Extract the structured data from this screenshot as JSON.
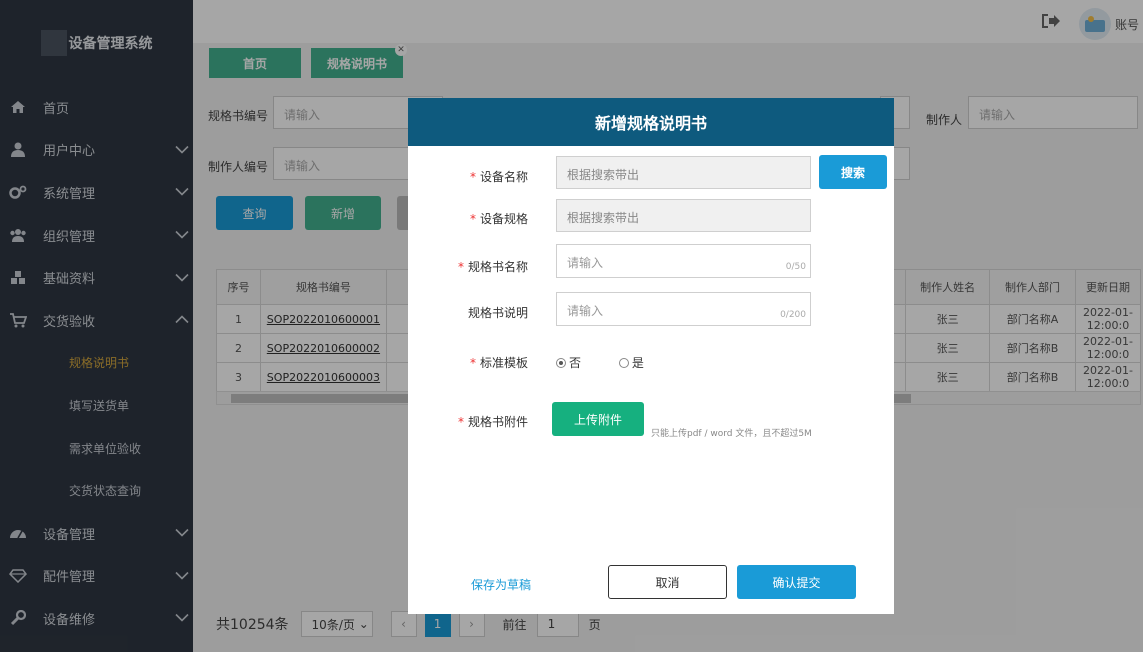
{
  "sidebar": {
    "brand": "设备管理系统",
    "items": [
      {
        "label": "首页",
        "icon": "home-icon",
        "chevron": ""
      },
      {
        "label": "用户中心",
        "icon": "user-icon",
        "chevron": "down"
      },
      {
        "label": "系统管理",
        "icon": "gears-icon",
        "chevron": "down"
      },
      {
        "label": "组织管理",
        "icon": "group-icon",
        "chevron": "down"
      },
      {
        "label": "基础资料",
        "icon": "cubes-icon",
        "chevron": "down"
      },
      {
        "label": "交货验收",
        "icon": "cart-icon",
        "chevron": "up"
      }
    ],
    "subitems": [
      "规格说明书",
      "填写送货单",
      "需求单位验收",
      "交货状态查询"
    ],
    "items2": [
      {
        "label": "设备管理",
        "icon": "dashboard-icon"
      },
      {
        "label": "配件管理",
        "icon": "diamond-icon"
      },
      {
        "label": "设备维修",
        "icon": "wrench-icon"
      }
    ]
  },
  "topbar": {
    "account": "账号"
  },
  "tabs": {
    "home": "首页",
    "spec": "规格说明书"
  },
  "filters": {
    "spec_code_label": "规格书编号",
    "creator_code_label": "制作人编号",
    "creator_label": "制作人",
    "placeholder": "请输入"
  },
  "buttons": {
    "query": "查询",
    "add": "新增"
  },
  "table": {
    "headers": [
      "序号",
      "规格书编号",
      "规",
      "制作人姓名",
      "制作人部门",
      "更新日期"
    ],
    "rows": [
      {
        "no": "1",
        "code": "SOP2022010600001",
        "name": "张三",
        "dept": "部门名称A",
        "date1": "2022-01-",
        "date2": "12:00:0"
      },
      {
        "no": "2",
        "code": "SOP2022010600002",
        "name": "张三",
        "dept": "部门名称B",
        "date1": "2022-01-",
        "date2": "12:00:0"
      },
      {
        "no": "3",
        "code": "SOP2022010600003",
        "name": "张三",
        "dept": "部门名称B",
        "date1": "2022-01-",
        "date2": "12:00:0"
      }
    ]
  },
  "pager": {
    "total": "共10254条",
    "page_size": "10条/页",
    "current": "1",
    "goto_label": "前往",
    "goto_value": "1",
    "page_suffix": "页"
  },
  "modal": {
    "title": "新增规格说明书",
    "device_name_label": "设备名称",
    "device_name_placeholder": "根据搜索带出",
    "search": "搜索",
    "device_spec_label": "设备规格",
    "device_spec_placeholder": "根据搜索带出",
    "spec_name_label": "规格书名称",
    "spec_name_placeholder": "请输入",
    "spec_name_count": "0/50",
    "spec_desc_label": "规格书说明",
    "spec_desc_placeholder": "请输入",
    "spec_desc_count": "0/200",
    "template_label": "标准模板",
    "template_no": "否",
    "template_yes": "是",
    "attachment_label": "规格书附件",
    "upload": "上传附件",
    "upload_hint": "只能上传pdf / word 文件，且不超过5M",
    "save_draft": "保存为草稿",
    "cancel": "取消",
    "submit": "确认提交"
  },
  "colors": {
    "primary": "#1a9bd7",
    "green": "#16b07f",
    "header": "#0e5a7e",
    "sidebar": "#2f3742",
    "active": "#d4a73e"
  }
}
